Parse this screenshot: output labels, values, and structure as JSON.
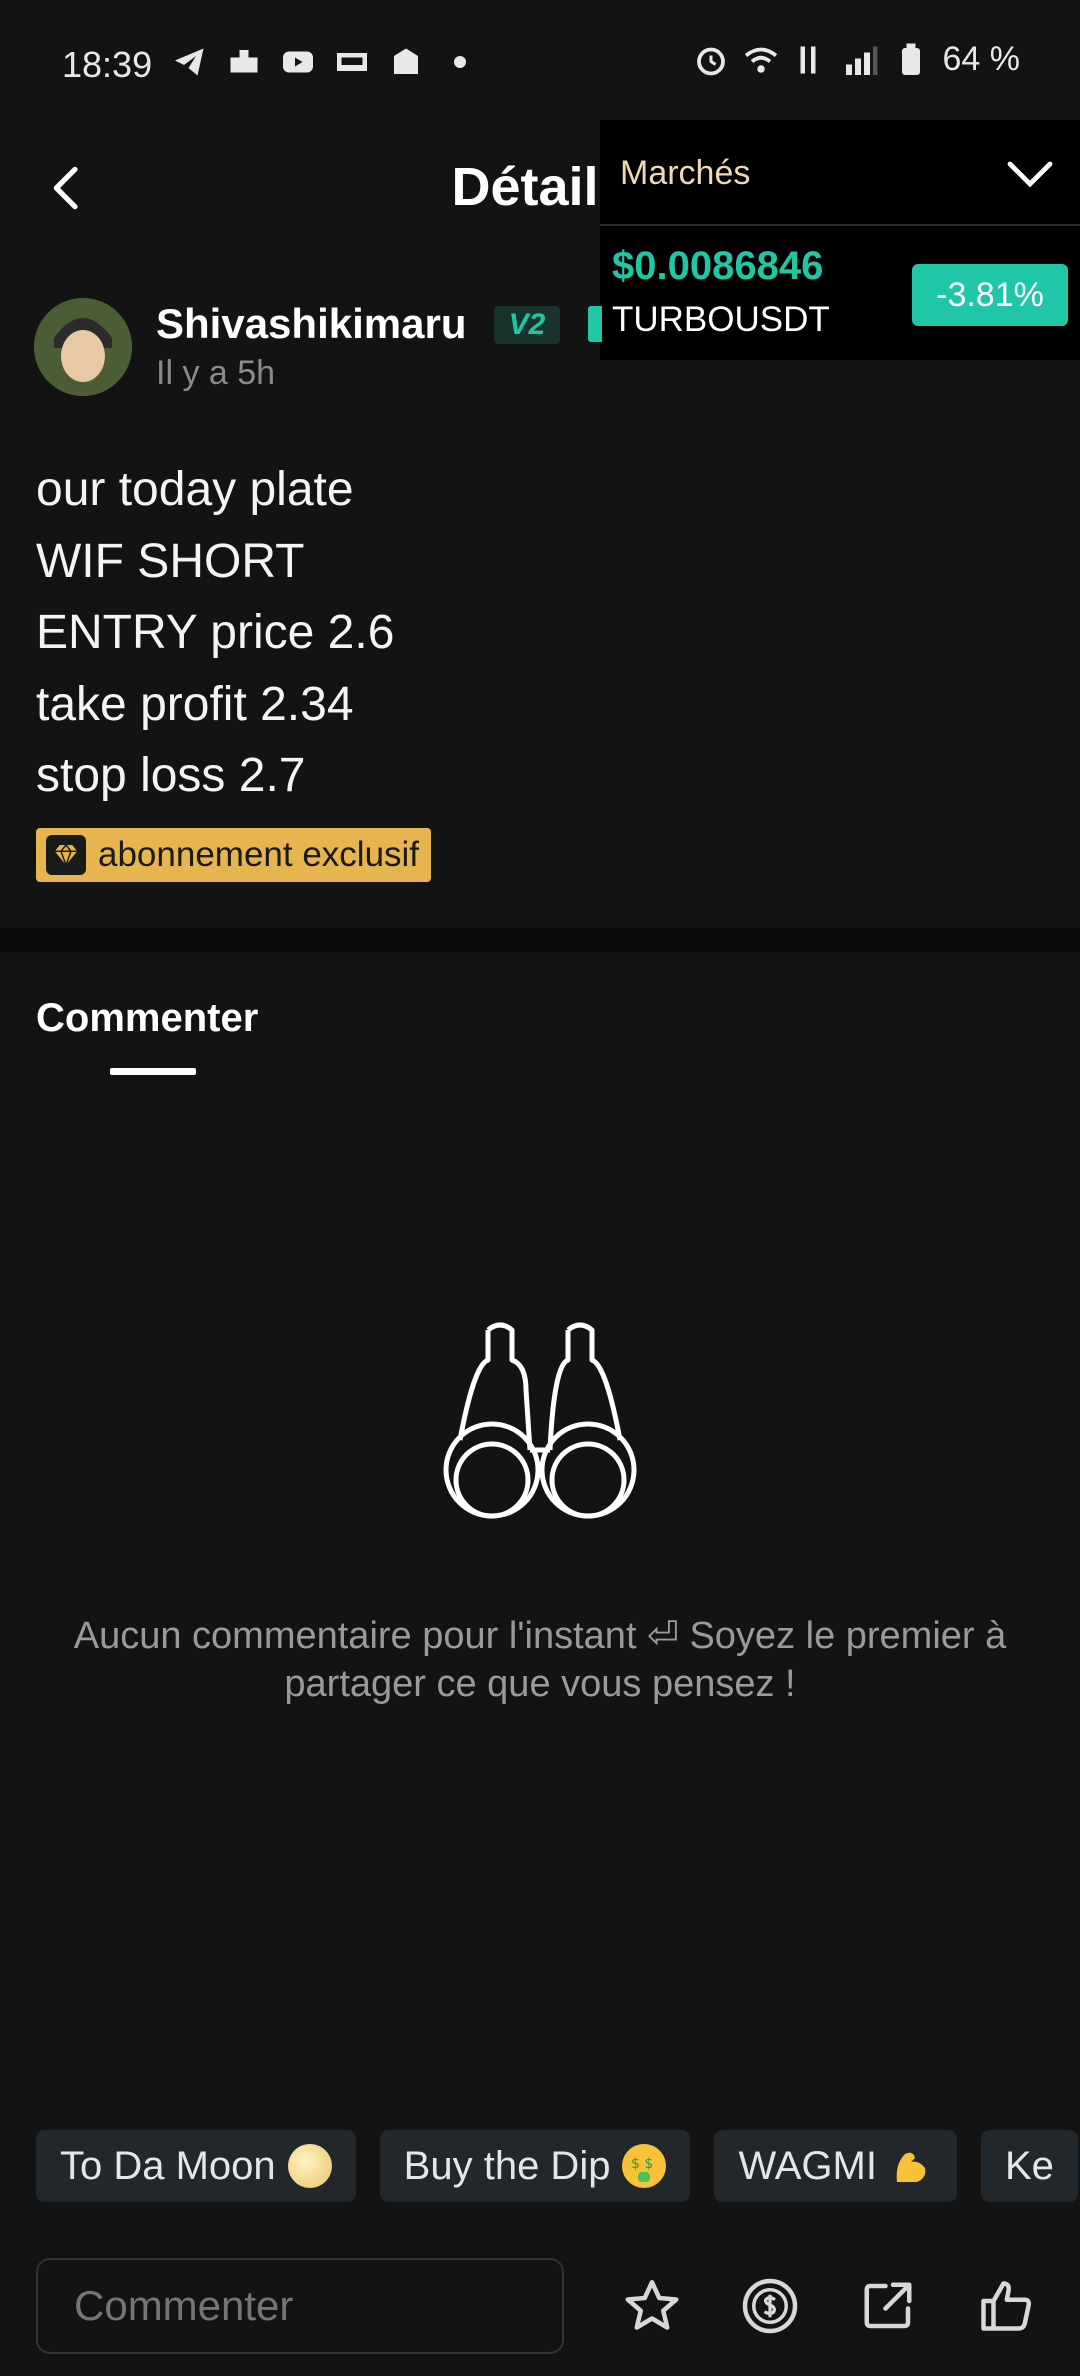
{
  "status_bar": {
    "time": "18:39",
    "battery": "64 %"
  },
  "header": {
    "title": "Détails"
  },
  "markets": {
    "label": "Marchés",
    "price": "$0.0086846",
    "symbol": "TURBOUSDT",
    "change": "-3.81%"
  },
  "post": {
    "username": "Shivashikimaru",
    "level_badge": "V2",
    "timestamp": "Il y a 5h",
    "lines": [
      "our today plate",
      "WIF SHORT",
      "ENTRY price 2.6",
      "take profit 2.34",
      "stop loss 2.7"
    ],
    "exclusive_tag": "abonnement exclusif"
  },
  "comments": {
    "tab_label": "Commenter",
    "empty_message": "Aucun commentaire pour l'instant ⏎ Soyez le premier à partager ce que vous pensez !"
  },
  "reactions": [
    {
      "label": "To Da Moon",
      "emoji": "moon-emoji"
    },
    {
      "label": "Buy the Dip",
      "emoji": "money-face-emoji"
    },
    {
      "label": "WAGMI",
      "emoji": "flexed-biceps-emoji"
    },
    {
      "label": "Ke",
      "emoji": ""
    }
  ],
  "bottom_bar": {
    "comment_placeholder": "Commenter"
  },
  "colors": {
    "background": "#131313",
    "accent_green": "#1fc7a6",
    "gold": "#e7b54f"
  }
}
